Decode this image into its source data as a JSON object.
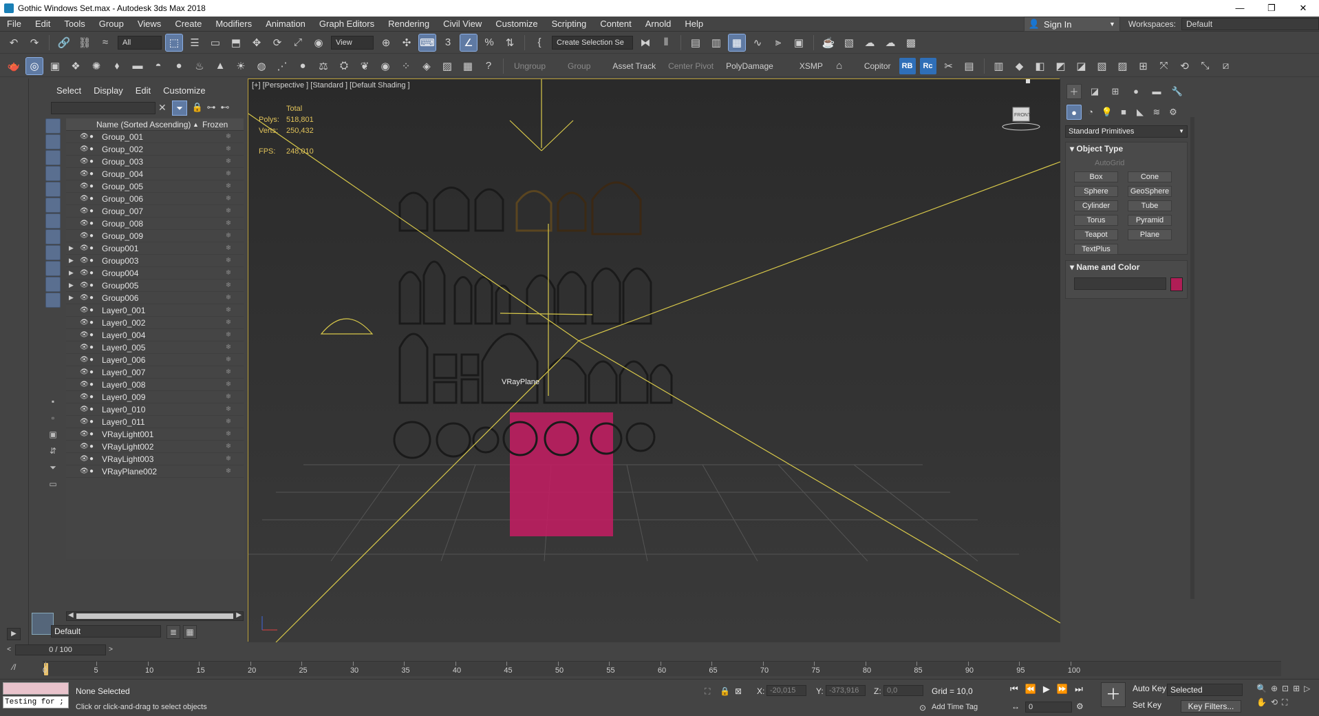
{
  "window": {
    "title": "Gothic Windows Set.max - Autodesk 3ds Max 2018",
    "minimize": "—",
    "restore": "❐",
    "close": "✕"
  },
  "menu": [
    "File",
    "Edit",
    "Tools",
    "Group",
    "Views",
    "Create",
    "Modifiers",
    "Animation",
    "Graph Editors",
    "Rendering",
    "Civil View",
    "Customize",
    "Scripting",
    "Content",
    "Arnold",
    "Help"
  ],
  "account": {
    "signin": "Sign In",
    "workspaces_label": "Workspaces:",
    "workspace_value": "Default"
  },
  "toolbar1": {
    "filter": "All",
    "refcoord": "View",
    "selection_set": "Create Selection Se"
  },
  "toolbar2": {
    "ungroup": "Ungroup",
    "group": "Group",
    "asset_track": "Asset Track",
    "center_pivot": "Center Pivot",
    "polydamage": "PolyDamage",
    "xsmp": "XSMP",
    "copitor": "Copitor",
    "rb": "RB",
    "rc": "Rc"
  },
  "explorer": {
    "tabs": [
      "Select",
      "Display",
      "Edit",
      "Customize"
    ],
    "col_name": "Name (Sorted Ascending)",
    "col_frozen": "Frozen",
    "sort_arrow": "▲",
    "rows": [
      {
        "name": "Group_001",
        "exp": false
      },
      {
        "name": "Group_002",
        "exp": false
      },
      {
        "name": "Group_003",
        "exp": false
      },
      {
        "name": "Group_004",
        "exp": false
      },
      {
        "name": "Group_005",
        "exp": false
      },
      {
        "name": "Group_006",
        "exp": false
      },
      {
        "name": "Group_007",
        "exp": false
      },
      {
        "name": "Group_008",
        "exp": false
      },
      {
        "name": "Group_009",
        "exp": false
      },
      {
        "name": "Group001",
        "exp": true
      },
      {
        "name": "Group003",
        "exp": true
      },
      {
        "name": "Group004",
        "exp": true
      },
      {
        "name": "Group005",
        "exp": true
      },
      {
        "name": "Group006",
        "exp": true
      },
      {
        "name": "Layer0_001",
        "exp": false
      },
      {
        "name": "Layer0_002",
        "exp": false
      },
      {
        "name": "Layer0_004",
        "exp": false
      },
      {
        "name": "Layer0_005",
        "exp": false
      },
      {
        "name": "Layer0_006",
        "exp": false
      },
      {
        "name": "Layer0_007",
        "exp": false
      },
      {
        "name": "Layer0_008",
        "exp": false
      },
      {
        "name": "Layer0_009",
        "exp": false
      },
      {
        "name": "Layer0_010",
        "exp": false
      },
      {
        "name": "Layer0_011",
        "exp": false
      },
      {
        "name": "VRayLight001",
        "exp": false
      },
      {
        "name": "VRayLight002",
        "exp": false
      },
      {
        "name": "VRayLight003",
        "exp": false
      },
      {
        "name": "VRayPlane002",
        "exp": false
      }
    ],
    "layer": "Default"
  },
  "viewport": {
    "label": "[+] [Perspective ] [Standard ] [Default Shading ]",
    "stats": {
      "total_label": "Total",
      "polys_label": "Polys:",
      "polys": "518,801",
      "verts_label": "Verts:",
      "verts": "250,432",
      "fps_label": "FPS:",
      "fps": "248,010"
    },
    "plane_label": "VRayPlane",
    "viewcube_label": "FRONT",
    "accent": "#bca13a",
    "plane_color": "#c21e62"
  },
  "command_panel": {
    "category": "Standard Primitives",
    "object_type_title": "Object Type",
    "autogrid": "AutoGrid",
    "primitives": [
      "Box",
      "Cone",
      "Sphere",
      "GeoSphere",
      "Cylinder",
      "Tube",
      "Torus",
      "Pyramid",
      "Teapot",
      "Plane",
      "TextPlus"
    ],
    "name_color_title": "Name and Color",
    "object_color": "#b01e56"
  },
  "timeline": {
    "slider": "0 / 100",
    "ticks": [
      "0",
      "5",
      "10",
      "15",
      "20",
      "25",
      "30",
      "35",
      "40",
      "45",
      "50",
      "55",
      "60",
      "65",
      "70",
      "75",
      "80",
      "85",
      "90",
      "95",
      "100"
    ]
  },
  "status": {
    "maxscript": "Testing for ;",
    "selection": "None Selected",
    "prompt": "Click or click-and-drag to select objects",
    "x_label": "X:",
    "x": "-20,015",
    "y_label": "Y:",
    "y": "-373,916",
    "z_label": "Z:",
    "z": "0,0",
    "grid": "Grid = 10,0",
    "add_time_tag": "Add Time Tag",
    "frame": "0",
    "auto_key": "Auto Key",
    "set_key": "Set Key",
    "key_mode": "Selected",
    "key_filters": "Key Filters..."
  }
}
